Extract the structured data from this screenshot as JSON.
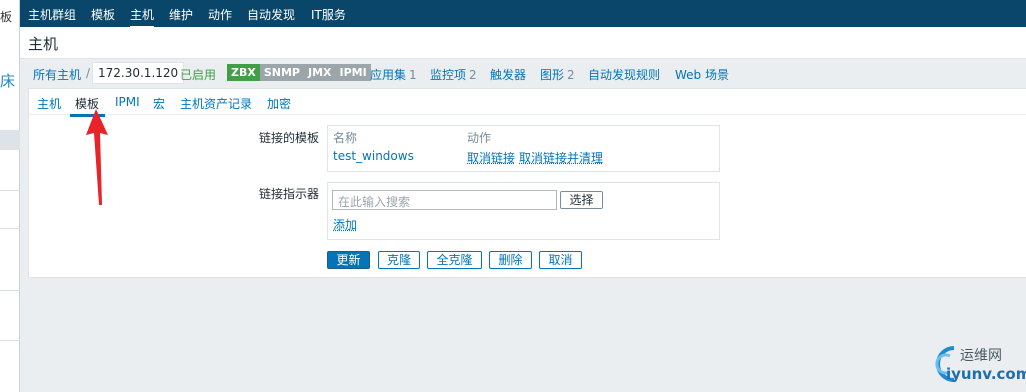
{
  "left_strip": {
    "frag_top": "板",
    "frag_mid": "床"
  },
  "topnav": {
    "items": [
      "主机群组",
      "模板",
      "主机",
      "维护",
      "动作",
      "自动发现",
      "IT服务"
    ]
  },
  "page": {
    "title": "主机"
  },
  "hostbar": {
    "all_hosts": "所有主机",
    "separator": "/",
    "host_name": "172.30.1.120",
    "status": "已启用",
    "badges": [
      "ZBX",
      "SNMP",
      "JMX",
      "IPMI"
    ],
    "applications": {
      "label": "应用集",
      "count": "1"
    },
    "items": {
      "label": "监控项",
      "count": "2"
    },
    "triggers": {
      "label": "触发器"
    },
    "graphs": {
      "label": "图形",
      "count": "2"
    },
    "discovery": {
      "label": "自动发现规则"
    },
    "web": {
      "label": "Web 场景"
    }
  },
  "tabs": [
    "主机",
    "模板",
    "IPMI",
    "宏",
    "主机资产记录",
    "加密"
  ],
  "form": {
    "linked_templates": {
      "label": "链接的模板",
      "col_name": "名称",
      "col_action": "动作",
      "rows": [
        {
          "name": "test_windows",
          "unlink": "取消链接",
          "unlink_clear": "取消链接并清理"
        }
      ]
    },
    "link_new": {
      "label": "链接指示器",
      "placeholder": "在此输入搜索",
      "select_button": "选择",
      "add_link": "添加"
    },
    "buttons": {
      "update": "更新",
      "clone": "克隆",
      "full_clone": "全克隆",
      "delete": "删除",
      "cancel": "取消"
    }
  },
  "annotation": {
    "arrow_color": "#e8232a"
  },
  "watermark": {
    "cn": "运维网",
    "en": "iyunv.com"
  }
}
